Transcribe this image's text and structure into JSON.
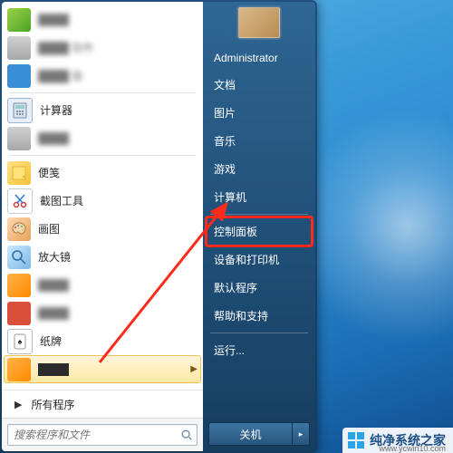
{
  "left": {
    "items": [
      {
        "label": "████",
        "type": "blur",
        "icon": "green"
      },
      {
        "label": "████ 软件",
        "type": "blur",
        "icon": "gray"
      },
      {
        "label": "████ 版",
        "type": "blur",
        "icon": "blue"
      },
      {
        "label": "计算器",
        "type": "text",
        "icon": "calc"
      },
      {
        "label": "████",
        "type": "blur",
        "icon": "gray"
      },
      {
        "label": "便笺",
        "type": "text",
        "icon": "note"
      },
      {
        "label": "截图工具",
        "type": "text",
        "icon": "snip"
      },
      {
        "label": "画图",
        "type": "text",
        "icon": "paint"
      },
      {
        "label": "放大镜",
        "type": "text",
        "icon": "mag"
      },
      {
        "label": "████",
        "type": "blur",
        "icon": "orange"
      },
      {
        "label": "████",
        "type": "blur",
        "icon": "red"
      },
      {
        "label": "纸牌",
        "type": "text",
        "icon": "card"
      },
      {
        "label": "████",
        "type": "hover",
        "icon": "orange"
      }
    ],
    "all_programs": "所有程序",
    "search_placeholder": "搜索程序和文件"
  },
  "right": {
    "user": "Administrator",
    "items_top": [
      "文档",
      "图片",
      "音乐",
      "游戏",
      "计算机"
    ],
    "items_mid": [
      "控制面板",
      "设备和打印机",
      "默认程序",
      "帮助和支持"
    ],
    "run": "运行...",
    "shutdown": "关机"
  },
  "highlight_item": "控制面板",
  "watermark": {
    "text": "纯净系统之家",
    "url": "www.ycwin10.com"
  }
}
